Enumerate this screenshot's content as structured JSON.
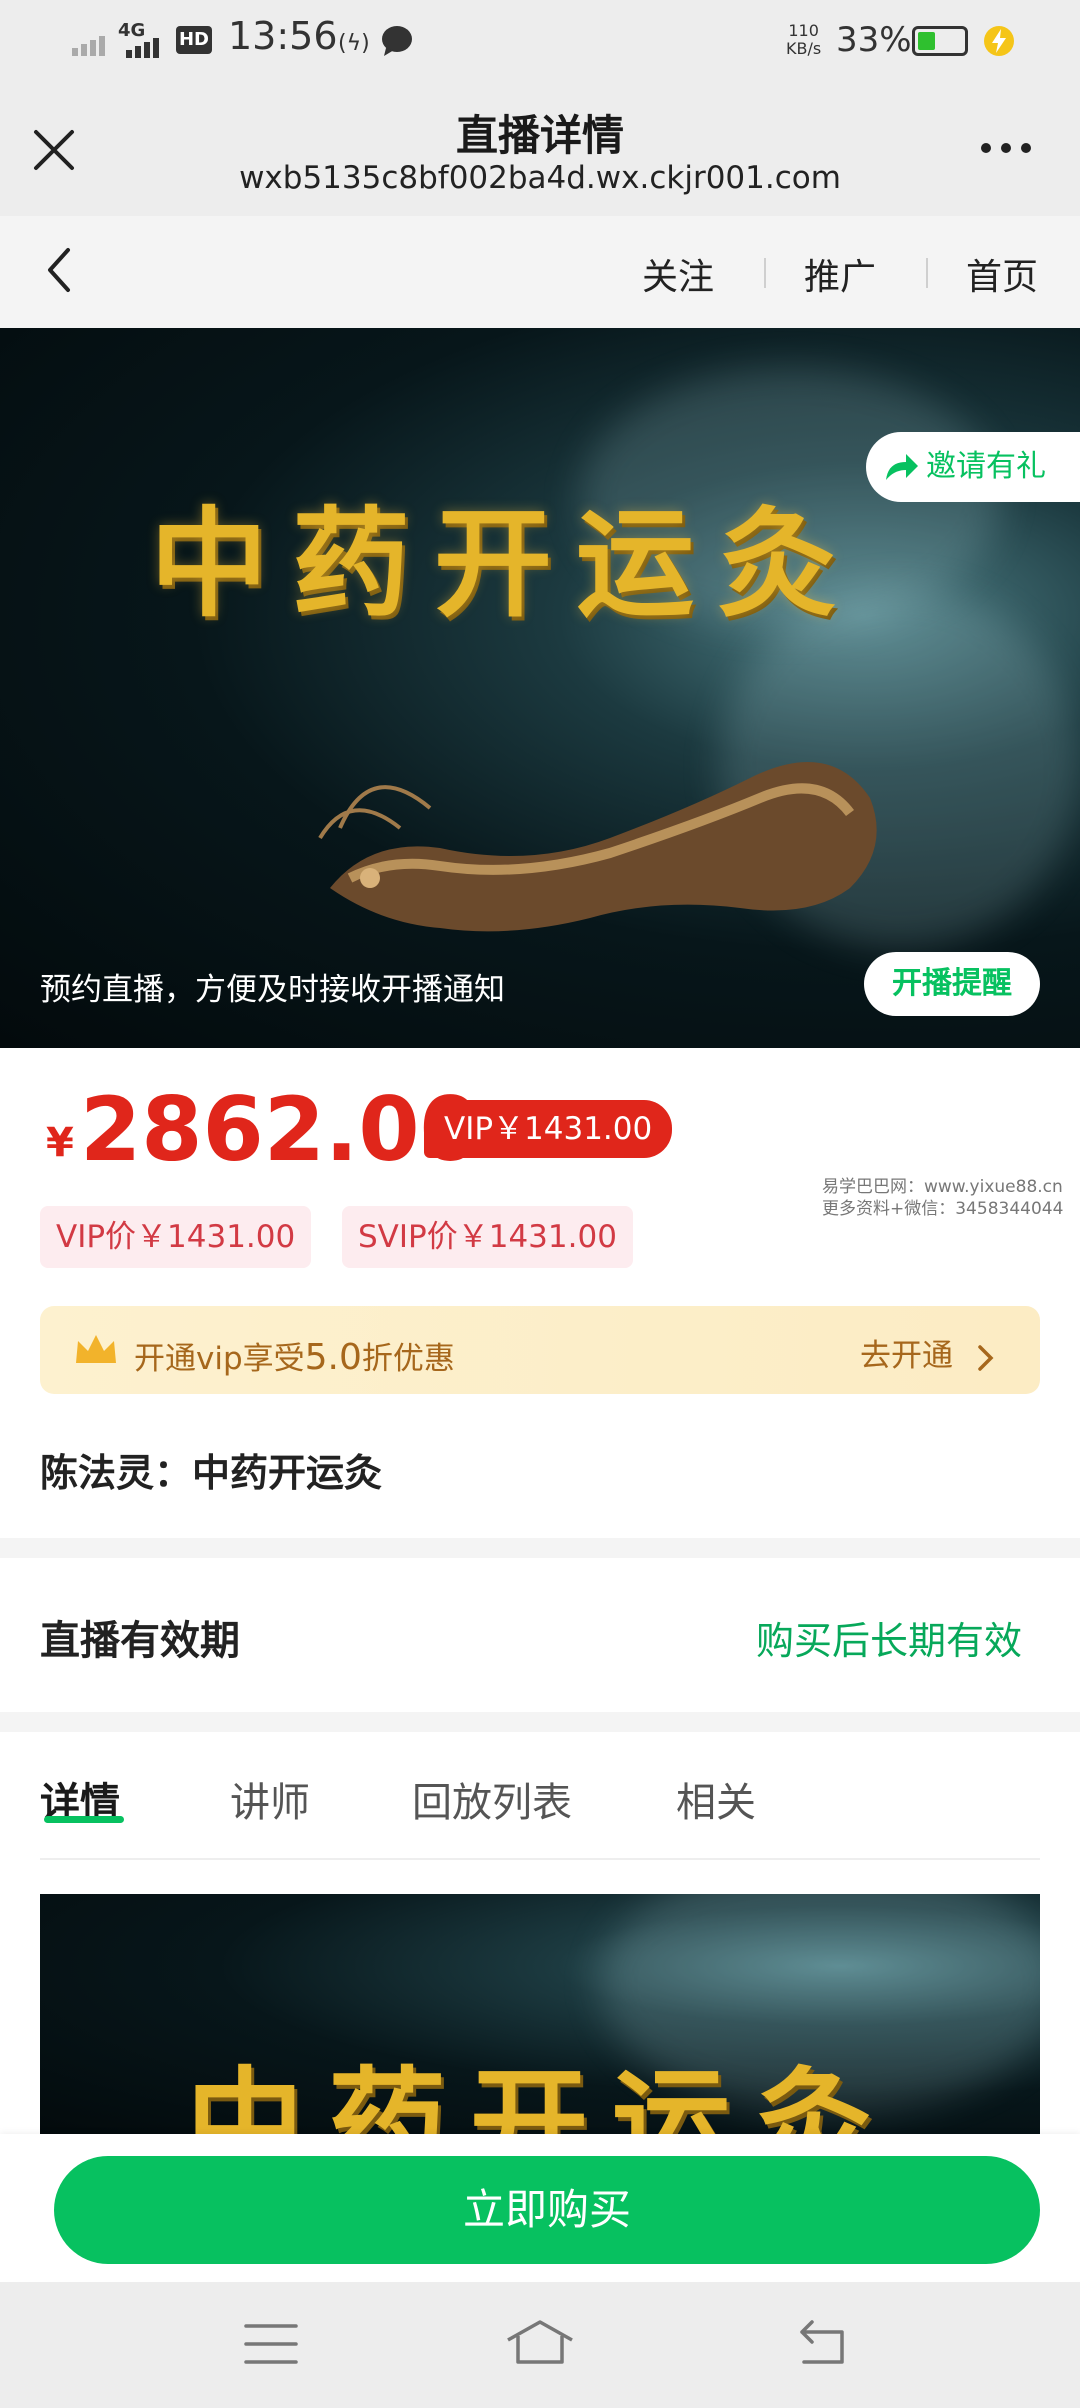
{
  "status_bar": {
    "network": "4G",
    "hd": "HD",
    "time": "13:56",
    "speed_value": "110",
    "speed_unit": "KB/s",
    "battery": "33%"
  },
  "titlebar": {
    "title": "直播详情",
    "url": "wxb5135c8bf002ba4d.wx.ckjr001.com"
  },
  "nav": {
    "follow": "关注",
    "promote": "推广",
    "home": "首页"
  },
  "banner": {
    "title_art": "中药开运灸",
    "invite": "邀请有礼",
    "note": "预约直播，方便及时接收开播通知",
    "remind": "开播提醒"
  },
  "price": {
    "currency": "¥",
    "value": "2862.00",
    "vip_tag": "VIP￥1431.00",
    "vip_price": "VIP价￥1431.00",
    "svip_price": "SVIP价￥1431.00"
  },
  "watermark": {
    "line1": "易学巴巴网：www.yixue88.cn",
    "line2": "更多资料+微信：3458344044"
  },
  "vip_bar": {
    "text_prefix": "开通vip享受",
    "discount": "5.0",
    "text_suffix": "折优惠",
    "open": "去开通"
  },
  "course_name": "陈法灵：中药开运灸",
  "validity": {
    "label": "直播有效期",
    "value": "购买后长期有效"
  },
  "tabs": [
    "详情",
    "讲师",
    "回放列表",
    "相关"
  ],
  "buy_button": "立即购买",
  "colors": {
    "brand_green": "#07c160",
    "price_red": "#e0261b",
    "vip_gold_text": "#a6671c"
  }
}
